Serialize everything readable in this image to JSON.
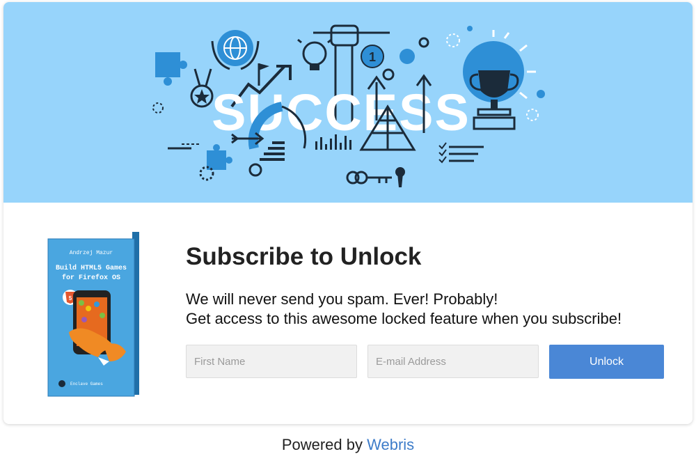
{
  "banner": {
    "headline": "SUCCESS",
    "icons": [
      "puzzle-icon",
      "globe-laurel-icon",
      "lightbulb-icon",
      "raised-fist-icon",
      "scales-icon",
      "trophy-icon",
      "medal-icon",
      "growth-arrow-icon",
      "flag-icon",
      "pyramid-icon",
      "key-icon",
      "keyhole-icon",
      "target-arrow-icon",
      "gauge-icon",
      "bar-chart-icon",
      "checklist-icon",
      "sun-icon"
    ],
    "scale_number": "1"
  },
  "book": {
    "author": "Andrzej Mazur",
    "title_line1": "Build HTML5 Games",
    "title_line2": "for Firefox OS",
    "badge": "5",
    "publisher": "Enclave Games"
  },
  "optin": {
    "heading": "Subscribe to Unlock",
    "line1": "We will never send you spam. Ever! Probably!",
    "line2": "Get access to this awesome locked feature when you subscribe!",
    "first_name_placeholder": "First Name",
    "email_placeholder": "E-mail Address",
    "unlock_label": "Unlock"
  },
  "footer": {
    "powered_by": "Powered by",
    "brand": "Webris"
  },
  "colors": {
    "banner_bg": "#97d4fb",
    "accent_blue": "#2e8fd6",
    "button": "#4a87d6",
    "link": "#3d7cc9"
  }
}
